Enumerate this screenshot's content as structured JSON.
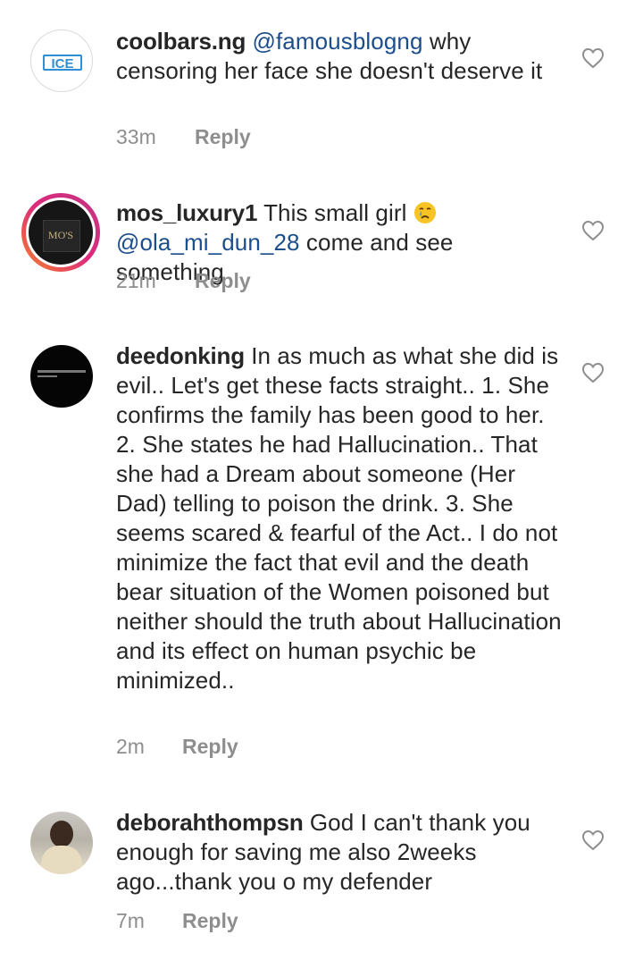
{
  "colors": {
    "text": "#262626",
    "meta": "#8e8e8e",
    "mention": "#1c4d8c",
    "heart_outline": "#8e8e8e",
    "ice_logo": "#2e8fd6",
    "story_ring_start": "#f58529",
    "story_ring_end": "#c13584"
  },
  "comments": [
    {
      "username": "coolbars.ng",
      "mention": "@famousblogng",
      "text": " why censoring her face she doesn't deserve it",
      "time": "33m",
      "reply_label": "Reply",
      "avatar_text": "ICE"
    },
    {
      "username": "mos_luxury1",
      "text_before": " This small girl ",
      "emoji": "crying-face-emoji",
      "mention": "@ola_mi_dun_28",
      "text_after": " come and see something",
      "time": "21m",
      "reply_label": "Reply",
      "avatar_text": "MO'S"
    },
    {
      "username": "deedonking",
      "text": " In as much as what she did is evil.. Let's get these facts straight.. 1. She confirms the family has been good to her. 2. She states he had Hallucination.. That she had a Dream about someone (Her Dad) telling to poison the drink. 3. She seems scared & fearful of the Act.. I do not minimize the fact that evil and the death bear situation of the Women poisoned but neither should the truth about Hallucination and its effect on human psychic be minimized..",
      "time": "2m",
      "reply_label": "Reply"
    },
    {
      "username": "deborahthompsn",
      "text": " God I can't thank you enough for saving me also 2weeks ago...thank you o my defender",
      "time": "7m",
      "reply_label": "Reply"
    }
  ]
}
